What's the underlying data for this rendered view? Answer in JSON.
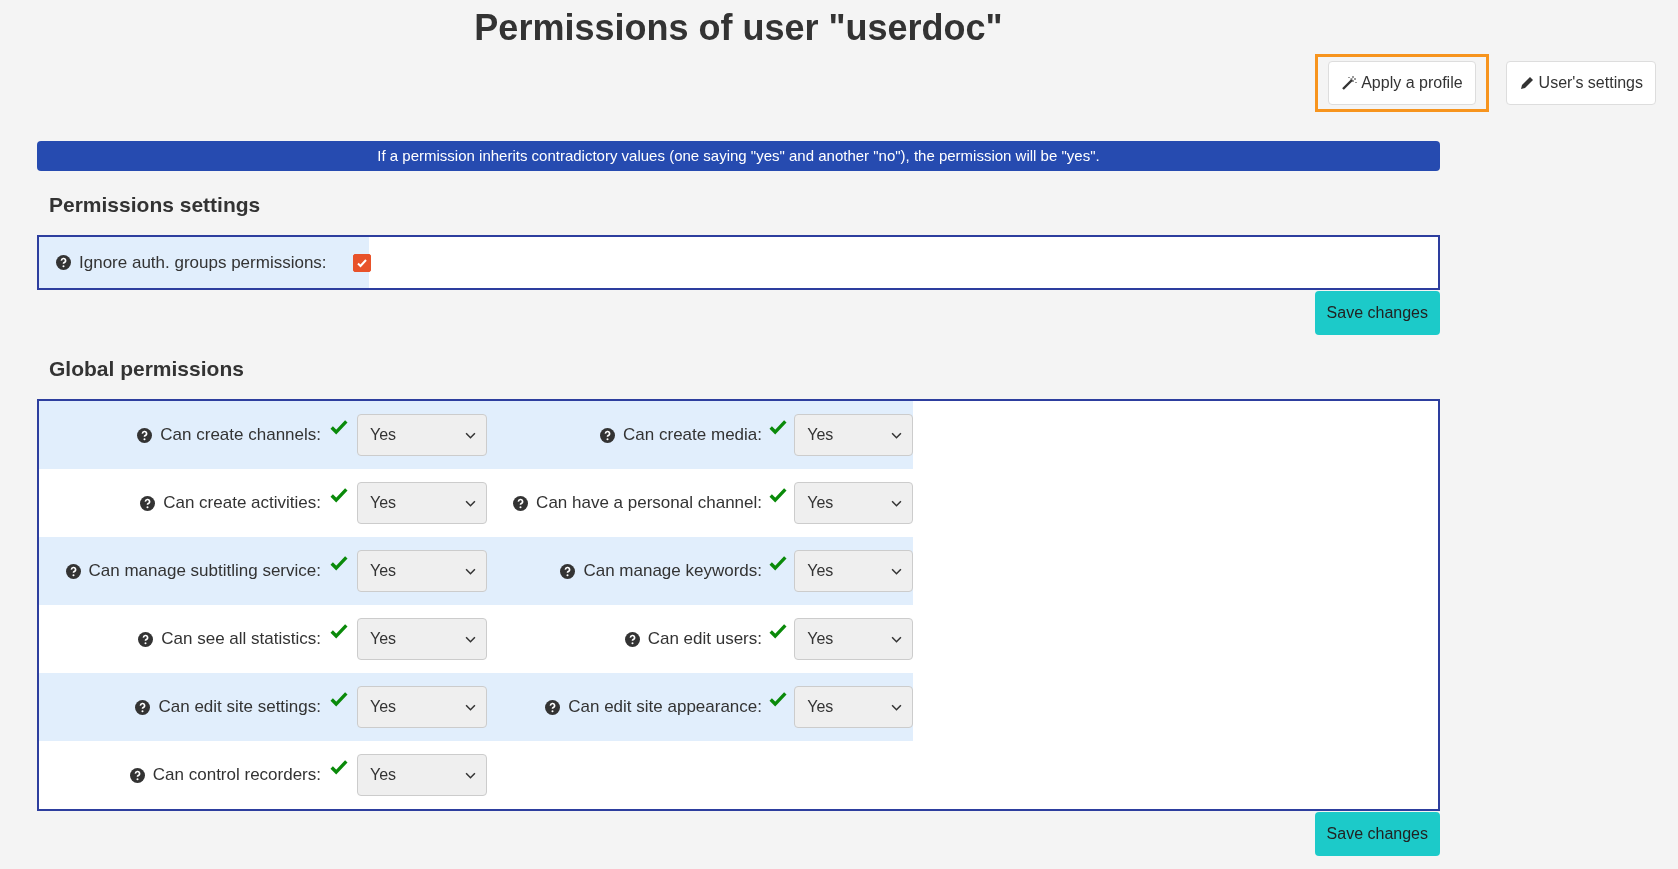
{
  "title": "Permissions of user \"userdoc\"",
  "actions": [
    {
      "label": "Apply a profile",
      "highlighted": true
    },
    {
      "label": "User's settings",
      "highlighted": false
    }
  ],
  "notice": "If a permission inherits contradictory values (one saying \"yes\" and another \"no\"), the permission will be \"yes\".",
  "permissions_settings": {
    "heading": "Permissions settings",
    "option": {
      "label": "Ignore auth. groups permissions:",
      "checked": true
    },
    "save": "Save changes"
  },
  "global_permissions": {
    "heading": "Global permissions",
    "save": "Save changes",
    "items": [
      {
        "label": "Can create channels:",
        "inherited": true,
        "value": "Yes"
      },
      {
        "label": "Can create media:",
        "inherited": true,
        "value": "Yes"
      },
      {
        "label": "Can create activities:",
        "inherited": true,
        "value": "Yes"
      },
      {
        "label": "Can have a personal channel:",
        "inherited": true,
        "value": "Yes"
      },
      {
        "label": "Can manage subtitling service:",
        "inherited": true,
        "value": "Yes"
      },
      {
        "label": "Can manage keywords:",
        "inherited": true,
        "value": "Yes"
      },
      {
        "label": "Can see all statistics:",
        "inherited": true,
        "value": "Yes"
      },
      {
        "label": "Can edit users:",
        "inherited": true,
        "value": "Yes"
      },
      {
        "label": "Can edit site settings:",
        "inherited": true,
        "value": "Yes"
      },
      {
        "label": "Can edit site appearance:",
        "inherited": true,
        "value": "Yes"
      },
      {
        "label": "Can control recorders:",
        "inherited": true,
        "value": "Yes"
      }
    ]
  }
}
